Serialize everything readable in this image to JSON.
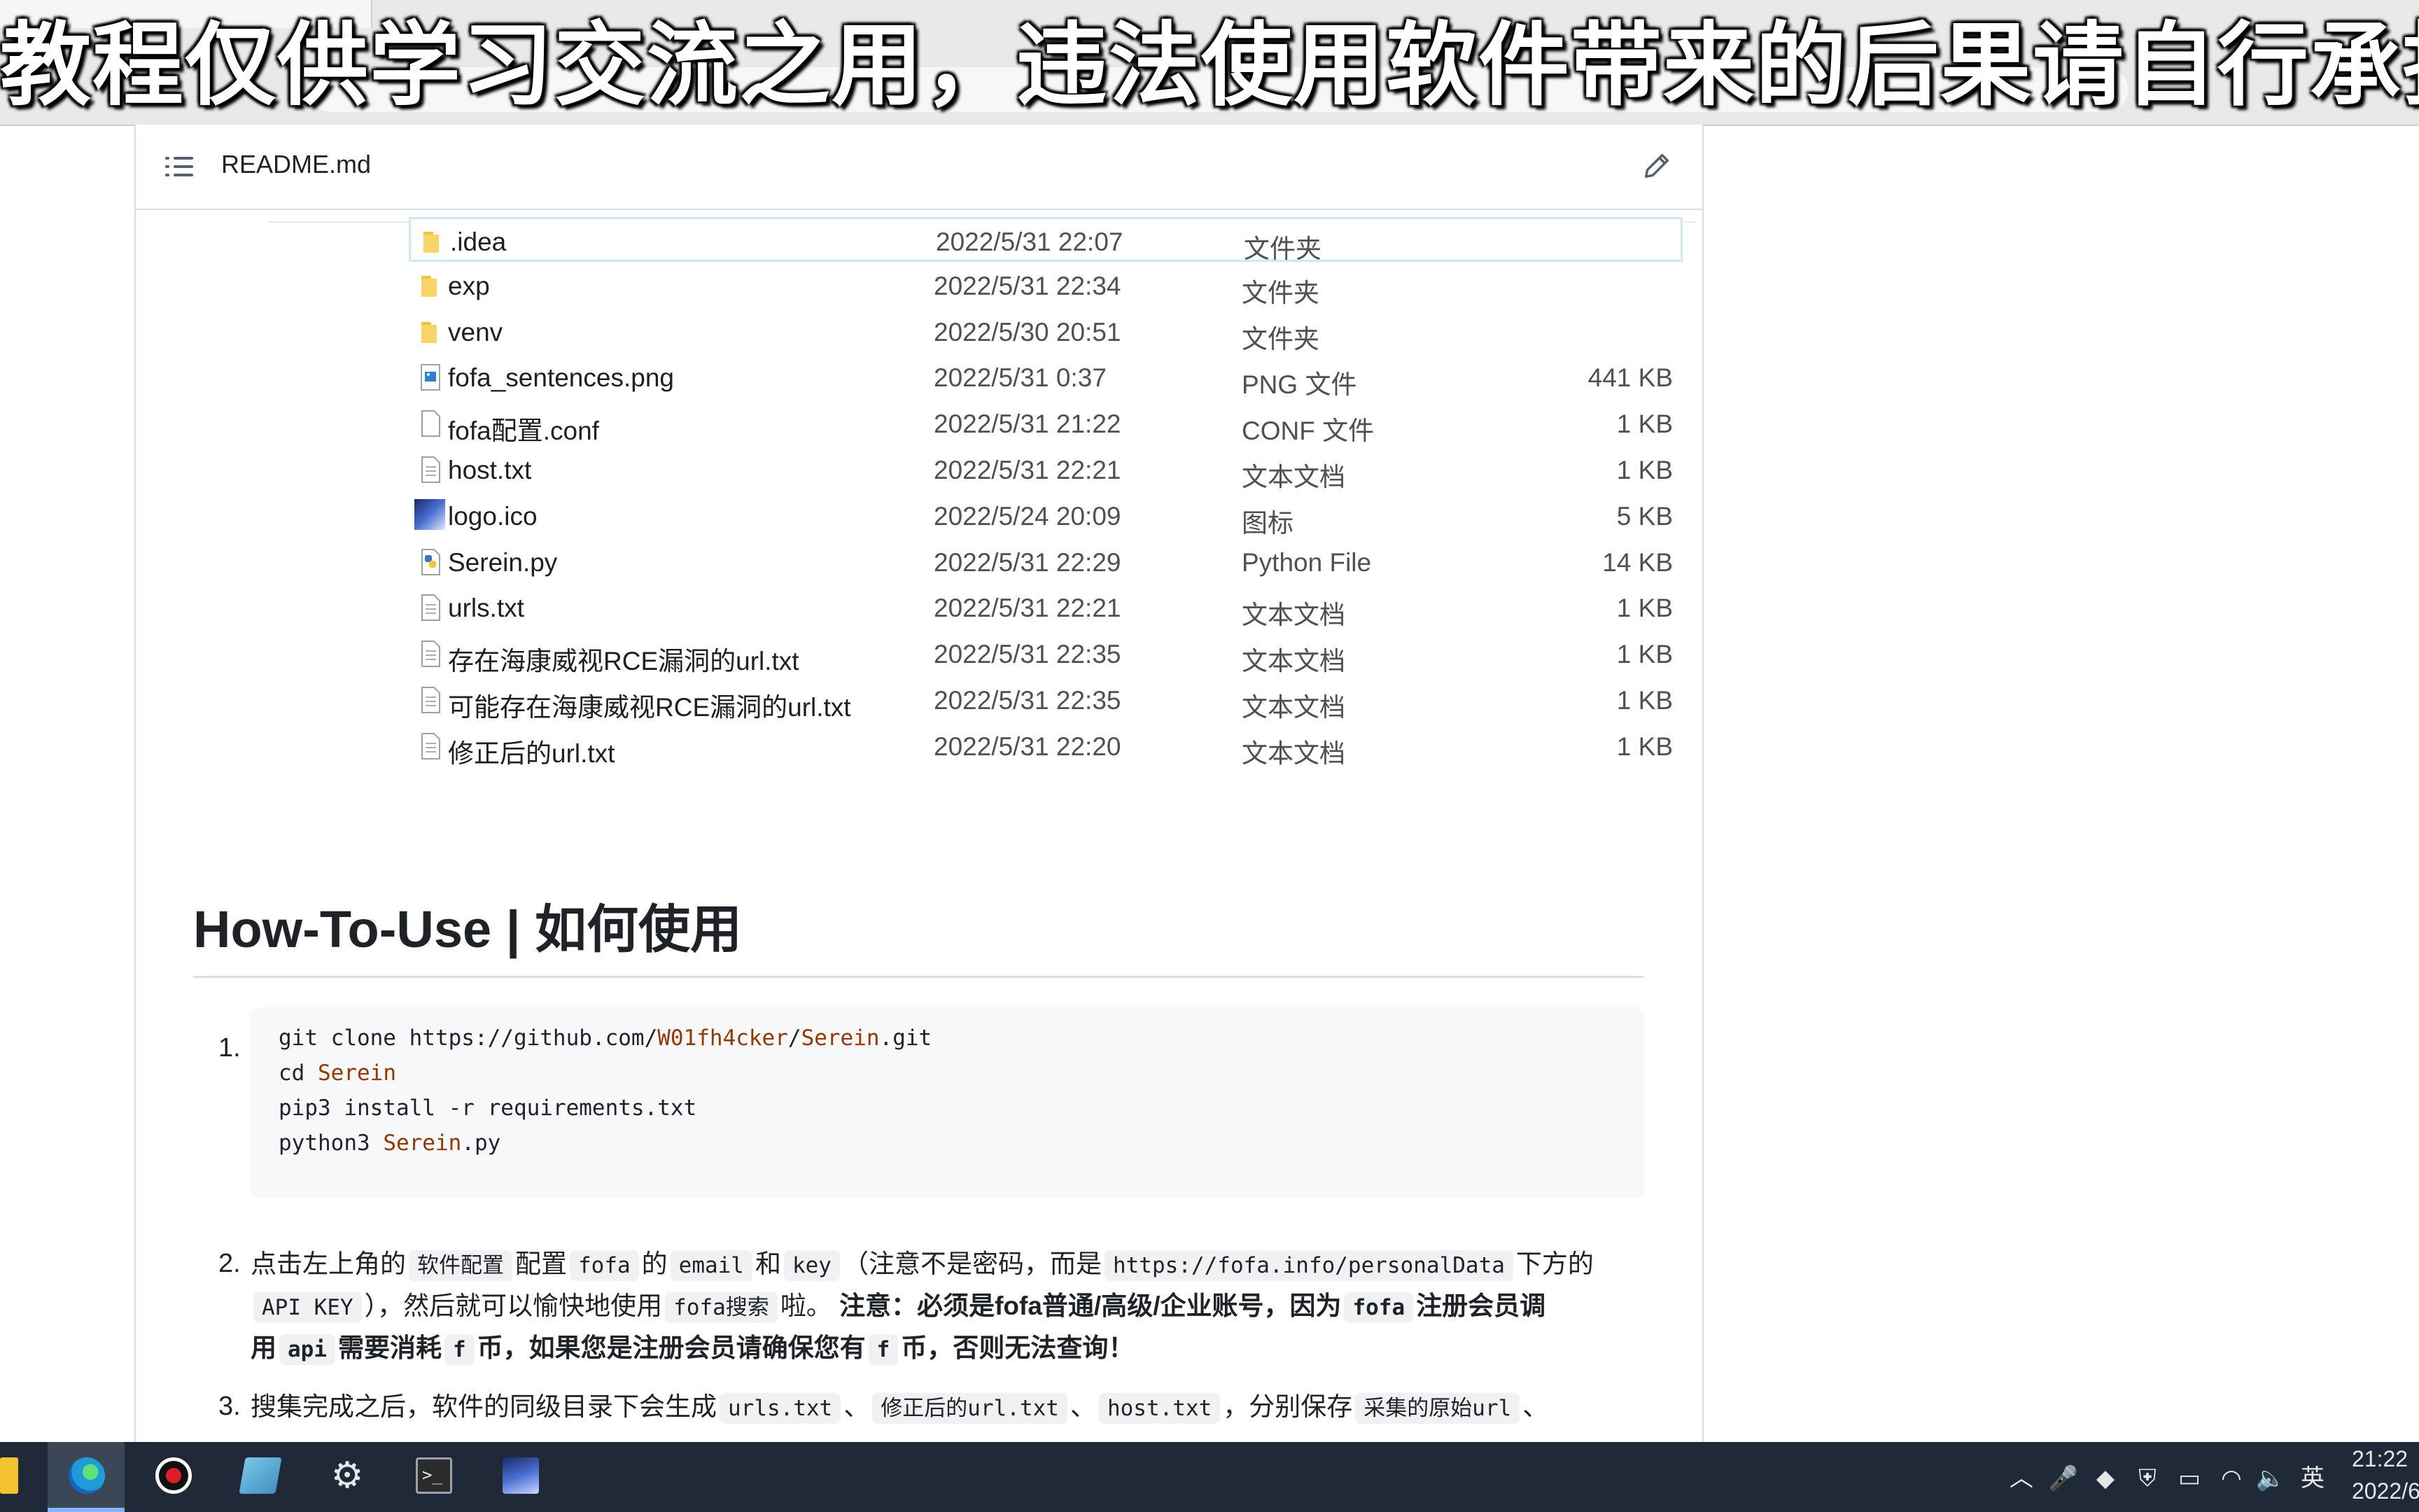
{
  "overlay_caption": "教程仅供学习交流之用，违法使用软件带来的后果请自行承担！",
  "readme": {
    "filename": "README.md",
    "list_icon": "list-icon",
    "edit_icon": "pencil-icon"
  },
  "files": [
    {
      "name": ".idea",
      "date": "2022/5/31 22:07",
      "type": "文件夹",
      "size": "",
      "icon": "folder-icon"
    },
    {
      "name": "exp",
      "date": "2022/5/31 22:34",
      "type": "文件夹",
      "size": "",
      "icon": "folder-icon"
    },
    {
      "name": "venv",
      "date": "2022/5/30 20:51",
      "type": "文件夹",
      "size": "",
      "icon": "folder-icon"
    },
    {
      "name": "fofa_sentences.png",
      "date": "2022/5/31 0:37",
      "type": "PNG 文件",
      "size": "441 KB",
      "icon": "image-file-icon"
    },
    {
      "name": "fofa配置.conf",
      "date": "2022/5/31 21:22",
      "type": "CONF 文件",
      "size": "1 KB",
      "icon": "blank-file-icon"
    },
    {
      "name": "host.txt",
      "date": "2022/5/31 22:21",
      "type": "文本文档",
      "size": "1 KB",
      "icon": "text-file-icon"
    },
    {
      "name": "logo.ico",
      "date": "2022/5/24 20:09",
      "type": "图标",
      "size": "5 KB",
      "icon": "ico-file-icon"
    },
    {
      "name": "Serein.py",
      "date": "2022/5/31 22:29",
      "type": "Python File",
      "size": "14 KB",
      "icon": "python-file-icon"
    },
    {
      "name": "urls.txt",
      "date": "2022/5/31 22:21",
      "type": "文本文档",
      "size": "1 KB",
      "icon": "text-file-icon"
    },
    {
      "name": "存在海康威视RCE漏洞的url.txt",
      "date": "2022/5/31 22:35",
      "type": "文本文档",
      "size": "1 KB",
      "icon": "text-file-icon"
    },
    {
      "name": "可能存在海康威视RCE漏洞的url.txt",
      "date": "2022/5/31 22:35",
      "type": "文本文档",
      "size": "1 KB",
      "icon": "text-file-icon"
    },
    {
      "name": "修正后的url.txt",
      "date": "2022/5/31 22:20",
      "type": "文本文档",
      "size": "1 KB",
      "icon": "text-file-icon"
    }
  ],
  "howto": {
    "heading": "How-To-Use | 如何使用",
    "step1_num": "1.",
    "code": {
      "l1_pre": "git clone https://github.com/",
      "l1_user": "W01fh4cker",
      "l1_sep": "/",
      "l1_repo": "Serein",
      "l1_post": ".git",
      "l2_pre": "cd ",
      "l2_dir": "Serein",
      "l3": "pip3 install -r requirements.txt",
      "l4_pre": "python3 ",
      "l4_file": "Serein",
      "l4_post": ".py"
    },
    "step2_num": "2.",
    "step2": {
      "t1": "点击左上角的",
      "c1": "软件配置",
      "t2": "配置",
      "c2": "fofa",
      "t3": "的",
      "c3": "email",
      "t4": "和",
      "c4": "key",
      "t5": "（注意不是密码，而是",
      "c5": "https://fofa.info/personalData",
      "t6": "下方的",
      "c6": "API KEY",
      "t7": "），然后就可以愉快地使用",
      "c7": "fofa搜索",
      "t8": "啦。",
      "b1": "注意：必须是fofa普通/高级/企业账号，因为",
      "bc1": "fofa",
      "b2": "注册会员调",
      "b3": "用",
      "bc2": "api",
      "b4": "需要消耗",
      "bc3": "f",
      "b5": "币，如果您是注册会员请确保您有",
      "bc4": "f",
      "b6": "币，否则无法查询！"
    },
    "step3_num": "3.",
    "step3": {
      "t1": "搜集完成之后，软件的同级目录下会生成",
      "c1": "urls.txt",
      "t2": "、",
      "c2": "修正后的url.txt",
      "t3": "、",
      "c3": "host.txt",
      "t4": "，分别保存",
      "c4": "采集的原始url",
      "t5": "、"
    }
  },
  "taskbar": {
    "apps": [
      "windows-start-icon",
      "edge-browser-icon",
      "screen-recorder-icon",
      "notebook-app-icon",
      "settings-gear-icon",
      "terminal-icon",
      "serein-app-icon"
    ],
    "tray_lang": "英",
    "clock_time": "21:22",
    "clock_date": "2022/6"
  }
}
